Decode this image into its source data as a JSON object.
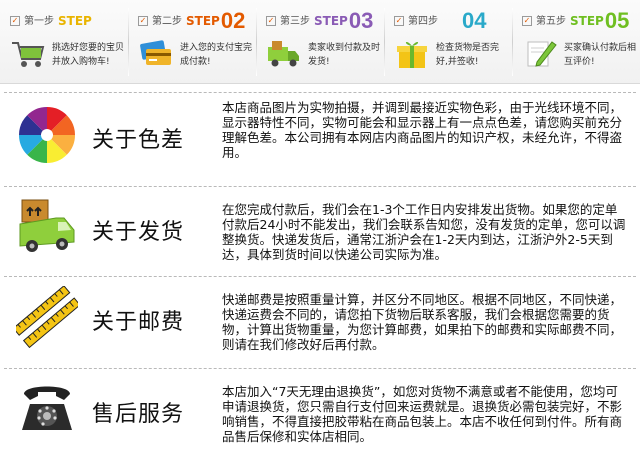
{
  "steps": [
    {
      "label": "第一步",
      "word": "STEP",
      "num": "",
      "desc": "挑选好您要的宝贝并放入购物车!",
      "icon": "shopping-cart-icon",
      "color": "#e9b400"
    },
    {
      "label": "第二步",
      "word": "STEP",
      "num": "02",
      "desc": "进入您的支付宝完成付款!",
      "icon": "credit-card-icon",
      "color": "#e35a00"
    },
    {
      "label": "第三步",
      "word": "STEP",
      "num": "03",
      "desc": "卖家收到付款及时发货!",
      "icon": "delivery-truck-icon",
      "color": "#8a5bb5"
    },
    {
      "label": "第四步",
      "word": "",
      "num": "04",
      "desc": "检查货物是否完好,并签收!",
      "icon": "gift-box-icon",
      "color": "#2aa9c9"
    },
    {
      "label": "第五步",
      "word": "STEP",
      "num": "05",
      "desc": "买家确认付款后相互评价!",
      "icon": "pen-icon",
      "color": "#6fbf21"
    }
  ],
  "sections": [
    {
      "title": "关于色差",
      "icon": "color-wheel-icon",
      "text": "本店商品图片为实物拍摄，并调到最接近实物色彩，由于光线环境不同，显示器特性不同，实物可能会和显示器上有一点点色差，请您购买前充分理解色差。本公司拥有本网店内商品图片的知识产权，未经允许，不得盗用。"
    },
    {
      "title": "关于发货",
      "icon": "delivery-truck-icon",
      "text": "在您完成付款后，我们会在1-3个工作日内安排发出货物。如果您的定单付款后24小时不能发出，我们会联系告知您，没有发货的定单，您可以调整换货。快递发货后，通常江浙沪会在1-2天内到达，江浙沪外2-5天到达，具体到货时间以快递公司实际为准。"
    },
    {
      "title": "关于邮费",
      "icon": "measuring-tape-icon",
      "text": "快递邮费是按照重量计算，并区分不同地区。根据不同地区，不同快递，快递运费会不同的，请您拍下货物后联系客服，我们会根据您需要的货物，计算出货物重量，为您计算邮费，如果拍下的邮费和实际邮费不同，则请在我们修改好后再付款。"
    },
    {
      "title": "售后服务",
      "icon": "telephone-icon",
      "text": "本店加入“7天无理由退换货”，如您对货物不满意或者不能使用，您均可申请退换货，您只需自行支付回来运费就是。退换货必需包装完好，不影响销售，不得直接把胶带粘在商品包装上。本店不收任何到付件。所有商品售后保修和实体店相同。"
    }
  ]
}
